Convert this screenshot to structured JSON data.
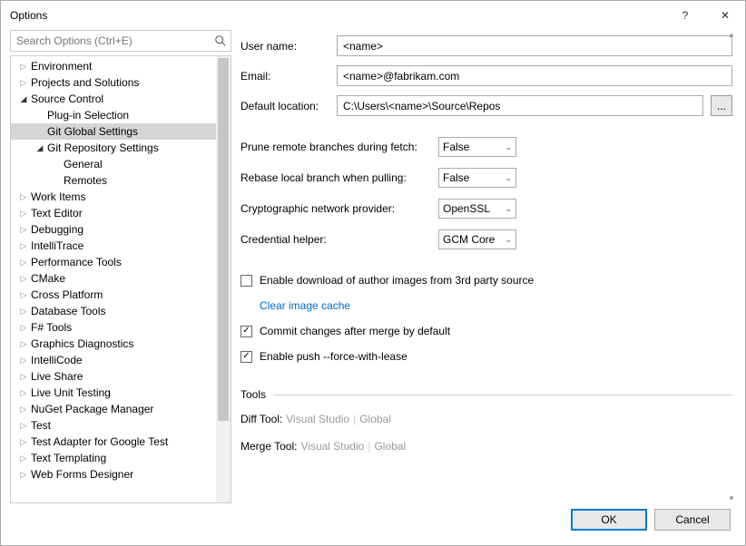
{
  "window": {
    "title": "Options",
    "help_icon": "?",
    "close_icon": "✕"
  },
  "search": {
    "placeholder": "Search Options (Ctrl+E)"
  },
  "tree": [
    {
      "label": "Environment",
      "level": 0,
      "expander": "▷",
      "selected": false
    },
    {
      "label": "Projects and Solutions",
      "level": 0,
      "expander": "▷",
      "selected": false
    },
    {
      "label": "Source Control",
      "level": 0,
      "expander": "◢",
      "selected": false
    },
    {
      "label": "Plug-in Selection",
      "level": 1,
      "expander": "",
      "selected": false
    },
    {
      "label": "Git Global Settings",
      "level": 1,
      "expander": "",
      "selected": true
    },
    {
      "label": "Git Repository Settings",
      "level": 1,
      "expander": "◢",
      "selected": false
    },
    {
      "label": "General",
      "level": 2,
      "expander": "",
      "selected": false
    },
    {
      "label": "Remotes",
      "level": 2,
      "expander": "",
      "selected": false
    },
    {
      "label": "Work Items",
      "level": 0,
      "expander": "▷",
      "selected": false
    },
    {
      "label": "Text Editor",
      "level": 0,
      "expander": "▷",
      "selected": false
    },
    {
      "label": "Debugging",
      "level": 0,
      "expander": "▷",
      "selected": false
    },
    {
      "label": "IntelliTrace",
      "level": 0,
      "expander": "▷",
      "selected": false
    },
    {
      "label": "Performance Tools",
      "level": 0,
      "expander": "▷",
      "selected": false
    },
    {
      "label": "CMake",
      "level": 0,
      "expander": "▷",
      "selected": false
    },
    {
      "label": "Cross Platform",
      "level": 0,
      "expander": "▷",
      "selected": false
    },
    {
      "label": "Database Tools",
      "level": 0,
      "expander": "▷",
      "selected": false
    },
    {
      "label": "F# Tools",
      "level": 0,
      "expander": "▷",
      "selected": false
    },
    {
      "label": "Graphics Diagnostics",
      "level": 0,
      "expander": "▷",
      "selected": false
    },
    {
      "label": "IntelliCode",
      "level": 0,
      "expander": "▷",
      "selected": false
    },
    {
      "label": "Live Share",
      "level": 0,
      "expander": "▷",
      "selected": false
    },
    {
      "label": "Live Unit Testing",
      "level": 0,
      "expander": "▷",
      "selected": false
    },
    {
      "label": "NuGet Package Manager",
      "level": 0,
      "expander": "▷",
      "selected": false
    },
    {
      "label": "Test",
      "level": 0,
      "expander": "▷",
      "selected": false
    },
    {
      "label": "Test Adapter for Google Test",
      "level": 0,
      "expander": "▷",
      "selected": false
    },
    {
      "label": "Text Templating",
      "level": 0,
      "expander": "▷",
      "selected": false
    },
    {
      "label": "Web Forms Designer",
      "level": 0,
      "expander": "▷",
      "selected": false
    }
  ],
  "form": {
    "username_label": "User name:",
    "username_value": "<name>",
    "email_label": "Email:",
    "email_value": "<name>@fabrikam.com",
    "location_label": "Default location:",
    "location_value": "C:\\Users\\<name>\\Source\\Repos",
    "browse_label": "..."
  },
  "dropdowns": {
    "prune_label": "Prune remote branches during fetch:",
    "prune_value": "False",
    "rebase_label": "Rebase local branch when pulling:",
    "rebase_value": "False",
    "crypto_label": "Cryptographic network provider:",
    "crypto_value": "OpenSSL",
    "cred_label": "Credential helper:",
    "cred_value": "GCM Core"
  },
  "checkboxes": {
    "download_images": "Enable download of author images from 3rd party source",
    "download_images_checked": false,
    "clear_cache": "Clear image cache",
    "commit_after_merge": "Commit changes after merge by default",
    "commit_after_merge_checked": true,
    "force_lease": "Enable push --force-with-lease",
    "force_lease_checked": true
  },
  "tools": {
    "header": "Tools",
    "diff_label": "Diff Tool:",
    "merge_label": "Merge Tool:",
    "opt1": "Visual Studio",
    "opt2": "Global",
    "divider": "|"
  },
  "buttons": {
    "ok": "OK",
    "cancel": "Cancel"
  },
  "chevron": "⌄"
}
